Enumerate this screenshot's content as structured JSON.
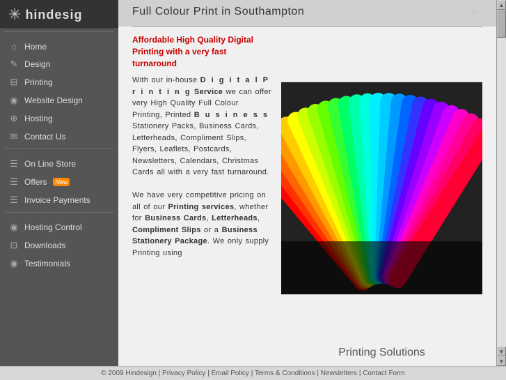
{
  "logo": {
    "text": "hindesig",
    "star": "✳"
  },
  "sidebar": {
    "nav_items": [
      {
        "id": "home",
        "label": "Home",
        "icon": "⌂"
      },
      {
        "id": "design",
        "label": "Design",
        "icon": "✎"
      },
      {
        "id": "printing",
        "label": "Printing",
        "icon": "⊟"
      },
      {
        "id": "website-design",
        "label": "Website Design",
        "icon": "◉"
      },
      {
        "id": "hosting",
        "label": "Hosting",
        "icon": "⊕"
      },
      {
        "id": "contact-us",
        "label": "Contact Us",
        "icon": "✉"
      }
    ],
    "store_items": [
      {
        "id": "online-store",
        "label": "On Line Store",
        "icon": "☰"
      },
      {
        "id": "offers",
        "label": "Offers",
        "icon": "☰",
        "badge": "New"
      },
      {
        "id": "invoice-payments",
        "label": "Invoice Payments",
        "icon": "☰"
      }
    ],
    "bottom_items": [
      {
        "id": "hosting-control",
        "label": "Hosting Control",
        "icon": "◉"
      },
      {
        "id": "downloads",
        "label": "Downloads",
        "icon": "⊡"
      },
      {
        "id": "testimonials",
        "label": "Testimonials",
        "icon": "◉"
      }
    ]
  },
  "header": {
    "title": "Full Colour Print in Southampton",
    "star_deco": "✦"
  },
  "main": {
    "headline": "Affordable High Quality Digital Printing with a very fast turnaround",
    "para1_text": "With our in-house",
    "para1_spaced": "D i g i t a l P r i n t i n g",
    "para1_bold": "Service",
    "para1_rest": " we can offer very High Quality Full Colour Printing, Printed",
    "para1_spaced2": "B u s i n e s s",
    "para1_rest2": "Stationery Packs, Business Cards, Letterheads, Compliment Slips, Flyers, Leaflets, Postcards, Newsletters, Calendars, Christmas Cards all with a very fast turnaround.",
    "para2": "We have very competitive pricing on all of our Printing services, whether for Business Cards, Letterheads, Compliment Slips or a Business Stationery Package. We only supply Printing using",
    "image_caption": "Printing Solutions"
  },
  "footer": {
    "copyright": "© 2009 Hindesign",
    "links": [
      {
        "label": "Privacy Policy"
      },
      {
        "label": "Email Policy"
      },
      {
        "label": "Terms & Conditions"
      },
      {
        "label": "Newsletters"
      },
      {
        "label": "Contact Form"
      }
    ],
    "separator": "|"
  }
}
